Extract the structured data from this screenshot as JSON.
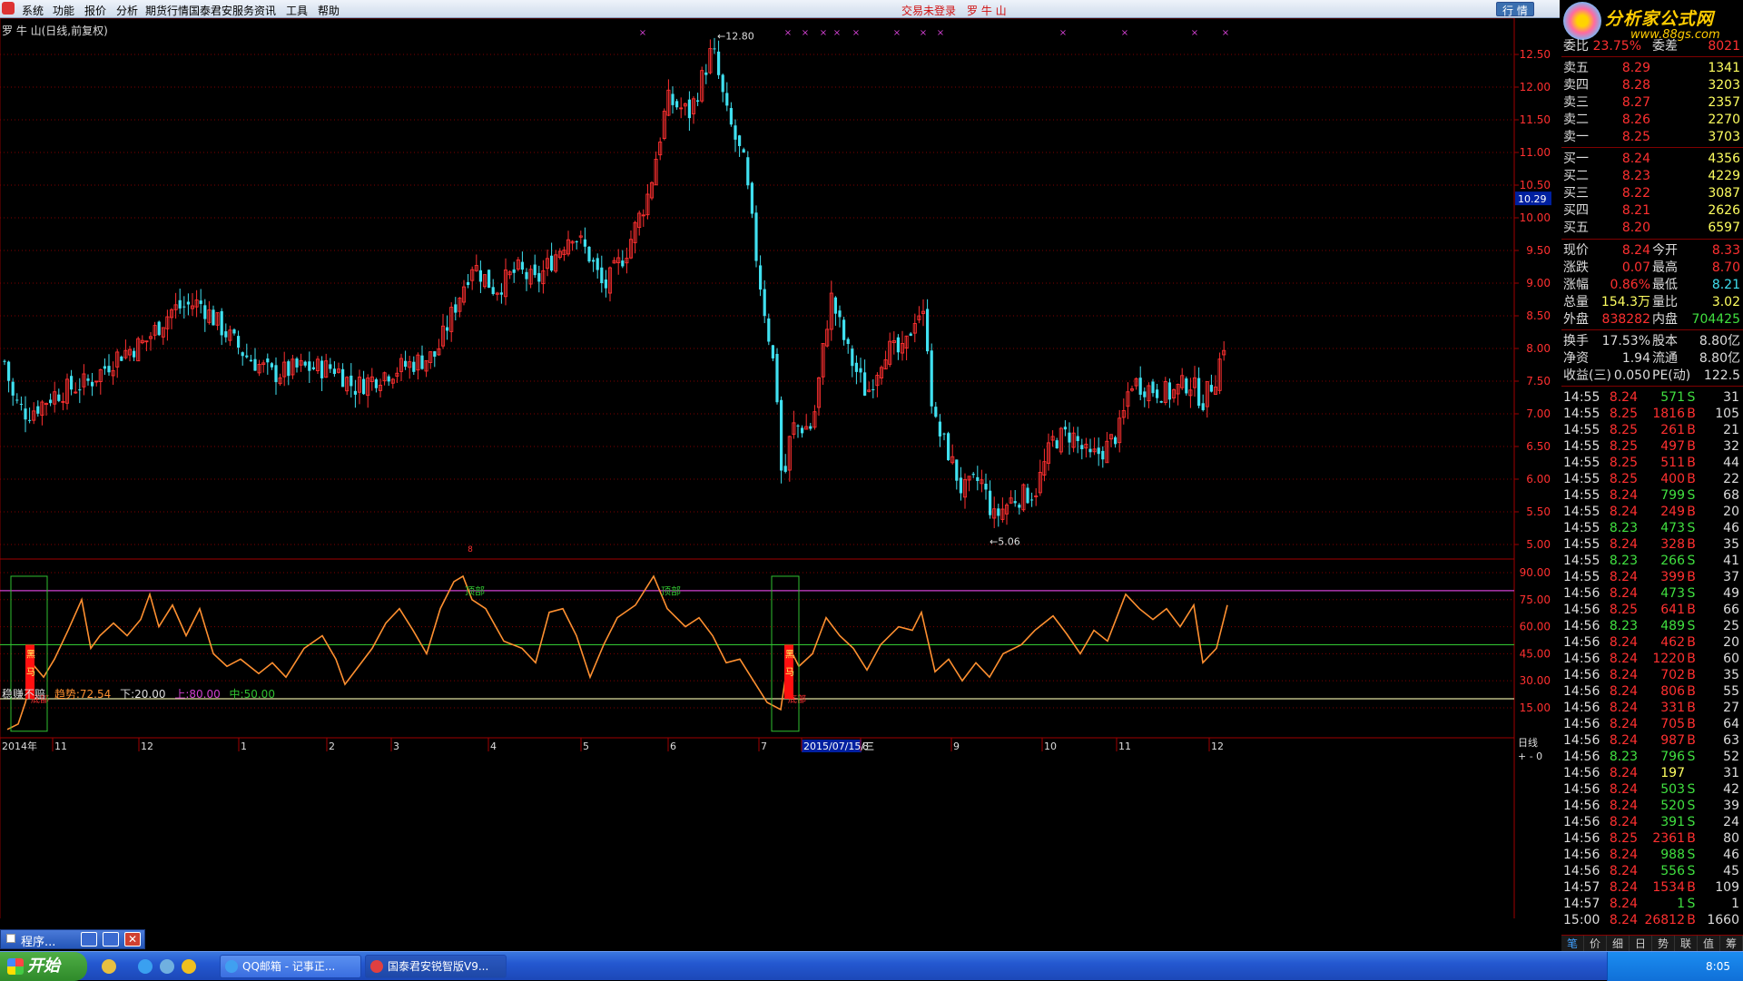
{
  "menubar": {
    "items": [
      "系统",
      "功能",
      "报价",
      "分析",
      "期货行情",
      "国泰君安服务",
      "资讯",
      "工具",
      "帮助"
    ],
    "status": "交易未登录",
    "stock_name": "罗 牛 山",
    "right_button": "行 情"
  },
  "brand": {
    "title": "分析家公式网",
    "url": "www.88gs.com"
  },
  "chart": {
    "title": "罗 牛 山(日线,前复权)",
    "max_label": "12.80",
    "min_label": "5.06",
    "current_price_tag": "10.29",
    "price_axis": [
      "12.50",
      "12.00",
      "11.50",
      "11.00",
      "10.50",
      "10.00",
      "9.50",
      "9.00",
      "8.50",
      "8.00",
      "7.50",
      "7.00",
      "6.50",
      "6.00",
      "5.50",
      "5.00"
    ],
    "indicator": {
      "name": "稳赚不赔",
      "trend_label": "趋势:",
      "trend_value": "72.54",
      "low_label": "下:",
      "low_value": "20.00",
      "up_label": "上:",
      "up_value": "80.00",
      "mid_label": "中:",
      "mid_value": "50.00"
    },
    "indicator_axis": [
      "90.00",
      "75.00",
      "60.00",
      "45.00",
      "30.00",
      "15.00"
    ],
    "top_label": "顶部",
    "bottom_label": "底部",
    "black_horse": "黑马",
    "x_axis": [
      "2014年",
      "11",
      "12",
      "1",
      "2",
      "3",
      "4",
      "5",
      "6",
      "7",
      "2015/07/15/三",
      "8",
      "9",
      "10",
      "11",
      "12"
    ],
    "period": "日线",
    "zoom_controls": [
      "+",
      "-",
      "0"
    ]
  },
  "quote": {
    "header": {
      "l1": "委比",
      "v1": "23.75%",
      "l2": "委差",
      "v2": "8021"
    },
    "asks": [
      {
        "label": "卖五",
        "price": "8.29",
        "vol": "1341"
      },
      {
        "label": "卖四",
        "price": "8.28",
        "vol": "3203"
      },
      {
        "label": "卖三",
        "price": "8.27",
        "vol": "2357"
      },
      {
        "label": "卖二",
        "price": "8.26",
        "vol": "2270"
      },
      {
        "label": "卖一",
        "price": "8.25",
        "vol": "3703"
      }
    ],
    "bids": [
      {
        "label": "买一",
        "price": "8.24",
        "vol": "4356"
      },
      {
        "label": "买二",
        "price": "8.23",
        "vol": "4229"
      },
      {
        "label": "买三",
        "price": "8.22",
        "vol": "3087"
      },
      {
        "label": "买四",
        "price": "8.21",
        "vol": "2626"
      },
      {
        "label": "买五",
        "price": "8.20",
        "vol": "6597"
      }
    ],
    "stats1": [
      {
        "l1": "现价",
        "v1": "8.24",
        "l2": "今开",
        "v2": "8.33"
      },
      {
        "l1": "涨跌",
        "v1": "0.07",
        "l2": "最高",
        "v2": "8.70"
      },
      {
        "l1": "涨幅",
        "v1": "0.86%",
        "l2": "最低",
        "v2": "8.21"
      },
      {
        "l1": "总量",
        "v1": "154.3万",
        "l2": "量比",
        "v2": "3.02"
      },
      {
        "l1": "外盘",
        "v1": "838282",
        "l2": "内盘",
        "v2": "704425"
      }
    ],
    "stats2": [
      {
        "l1": "换手",
        "v1": "17.53%",
        "l2": "股本",
        "v2": "8.80亿"
      },
      {
        "l1": "净资",
        "v1": "1.94",
        "l2": "流通",
        "v2": "8.80亿"
      },
      {
        "l1": "收益(三)",
        "v1": "0.050",
        "l2": "PE(动)",
        "v2": "122.5"
      }
    ],
    "ticks": [
      {
        "t": "14:55",
        "p": "8.24",
        "v": "571",
        "s": "S",
        "n": "31"
      },
      {
        "t": "14:55",
        "p": "8.25",
        "v": "1816",
        "s": "B",
        "n": "105"
      },
      {
        "t": "14:55",
        "p": "8.25",
        "v": "261",
        "s": "B",
        "n": "21"
      },
      {
        "t": "14:55",
        "p": "8.25",
        "v": "497",
        "s": "B",
        "n": "32"
      },
      {
        "t": "14:55",
        "p": "8.25",
        "v": "511",
        "s": "B",
        "n": "44"
      },
      {
        "t": "14:55",
        "p": "8.25",
        "v": "400",
        "s": "B",
        "n": "22"
      },
      {
        "t": "14:55",
        "p": "8.24",
        "v": "799",
        "s": "S",
        "n": "68"
      },
      {
        "t": "14:55",
        "p": "8.24",
        "v": "249",
        "s": "B",
        "n": "20"
      },
      {
        "t": "14:55",
        "p": "8.23",
        "v": "473",
        "s": "S",
        "n": "46"
      },
      {
        "t": "14:55",
        "p": "8.24",
        "v": "328",
        "s": "B",
        "n": "35"
      },
      {
        "t": "14:55",
        "p": "8.23",
        "v": "266",
        "s": "S",
        "n": "41"
      },
      {
        "t": "14:55",
        "p": "8.24",
        "v": "399",
        "s": "B",
        "n": "37"
      },
      {
        "t": "14:56",
        "p": "8.24",
        "v": "473",
        "s": "S",
        "n": "49"
      },
      {
        "t": "14:56",
        "p": "8.25",
        "v": "641",
        "s": "B",
        "n": "66"
      },
      {
        "t": "14:56",
        "p": "8.23",
        "v": "489",
        "s": "S",
        "n": "25"
      },
      {
        "t": "14:56",
        "p": "8.24",
        "v": "462",
        "s": "B",
        "n": "20"
      },
      {
        "t": "14:56",
        "p": "8.24",
        "v": "1220",
        "s": "B",
        "n": "60"
      },
      {
        "t": "14:56",
        "p": "8.24",
        "v": "702",
        "s": "B",
        "n": "35"
      },
      {
        "t": "14:56",
        "p": "8.24",
        "v": "806",
        "s": "B",
        "n": "55"
      },
      {
        "t": "14:56",
        "p": "8.24",
        "v": "331",
        "s": "B",
        "n": "27"
      },
      {
        "t": "14:56",
        "p": "8.24",
        "v": "705",
        "s": "B",
        "n": "64"
      },
      {
        "t": "14:56",
        "p": "8.24",
        "v": "987",
        "s": "B",
        "n": "63"
      },
      {
        "t": "14:56",
        "p": "8.23",
        "v": "796",
        "s": "S",
        "n": "52"
      },
      {
        "t": "14:56",
        "p": "8.24",
        "v": "197",
        "s": "",
        "n": "31"
      },
      {
        "t": "14:56",
        "p": "8.24",
        "v": "503",
        "s": "S",
        "n": "42"
      },
      {
        "t": "14:56",
        "p": "8.24",
        "v": "520",
        "s": "S",
        "n": "39"
      },
      {
        "t": "14:56",
        "p": "8.24",
        "v": "391",
        "s": "S",
        "n": "24"
      },
      {
        "t": "14:56",
        "p": "8.25",
        "v": "2361",
        "s": "B",
        "n": "80"
      },
      {
        "t": "14:56",
        "p": "8.24",
        "v": "988",
        "s": "S",
        "n": "46"
      },
      {
        "t": "14:56",
        "p": "8.24",
        "v": "556",
        "s": "S",
        "n": "45"
      },
      {
        "t": "14:57",
        "p": "8.24",
        "v": "1534",
        "s": "B",
        "n": "109"
      },
      {
        "t": "14:57",
        "p": "8.24",
        "v": "1",
        "s": "S",
        "n": "1"
      },
      {
        "t": "15:00",
        "p": "8.24",
        "v": "26812",
        "s": "B",
        "n": "1660"
      }
    ],
    "tabs": [
      "笔",
      "价",
      "细",
      "日",
      "势",
      "联",
      "值",
      "筹"
    ]
  },
  "program_box": {
    "label": "程序..."
  },
  "taskbar": {
    "start": "开始",
    "tasks": [
      "QQ邮箱 - 记事正...",
      "国泰君安锐智版V9..."
    ],
    "clock": "8:05"
  },
  "colors": {
    "up": "#ff3030",
    "down": "#40e0f0",
    "trend": "#ff9030",
    "upper": "#d040d0",
    "mid": "#30c030",
    "lower": "#e0e0a0"
  }
}
